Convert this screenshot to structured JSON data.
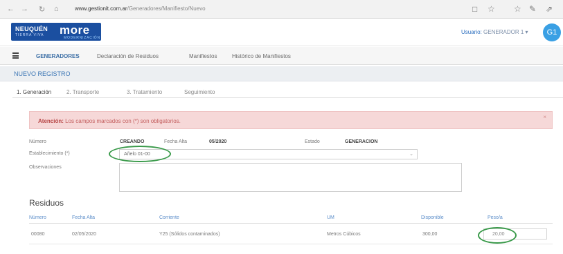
{
  "browser": {
    "back": "←",
    "forward": "→",
    "reload": "↻",
    "home": "⌂",
    "url_host": "www.gestionit.com.ar",
    "url_path": "/Generadores/Manifiesto/Nuevo",
    "icons": [
      "reading-view-icon",
      "favorite-star-icon",
      "favorites-hub-icon",
      "pen-icon",
      "share-icon"
    ],
    "right_glyphs": [
      "□",
      "☆",
      "☆",
      "✎",
      "⇗"
    ]
  },
  "header": {
    "logo_left": "NEUQUÉN",
    "logo_left_sub": "TIERRA VIVA",
    "logo_right": "more",
    "logo_right_sub": "MODERNIZACIÓN",
    "user_prefix": "Usuario:",
    "user_name": "GENERADOR 1",
    "user_caret": "▾",
    "avatar_initials": "G1"
  },
  "menu": {
    "items": [
      {
        "label": "GENERADORES",
        "active": true
      },
      {
        "label": "Declaración de Residuos",
        "active": false
      },
      {
        "label": "Manifiestos",
        "active": false
      },
      {
        "label": "Histórico de Manifiestos",
        "active": false
      }
    ]
  },
  "page": {
    "title": "NUEVO REGISTRO"
  },
  "tabs": [
    {
      "label": "1. Generación",
      "active": true
    },
    {
      "label": "2. Transporte",
      "active": false
    },
    {
      "label": "3. Tratamiento",
      "active": false
    },
    {
      "label": "Seguimiento",
      "active": false
    }
  ],
  "alert": {
    "strong": "Atención:",
    "text": "Los campos marcados con (*) son obligatorios.",
    "close": "×"
  },
  "form": {
    "numero_label": "Número",
    "numero_value": "CREANDO",
    "fecha_label": "Fecha Alta",
    "fecha_value": "05/2020",
    "estado_label": "Estado",
    "estado_value": "GENERACION",
    "establecimiento_label": "Establecimiento (*)",
    "establecimiento_value": "Añelo 01-00",
    "select_caret": "⌄",
    "observaciones_label": "Observaciones"
  },
  "residuos": {
    "title": "Residuos",
    "headers": [
      "Número",
      "Fecha Alta",
      "Corriente",
      "UM",
      "Disponible",
      "Peso/a"
    ],
    "rows": [
      [
        "00080",
        "02/05/2020",
        "Y25 (Sólidos contaminados)",
        "Metros Cúbicos",
        "300,00",
        "20,00"
      ]
    ]
  },
  "colors": {
    "brand_blue": "#1b4fa0",
    "accent_blue": "#3b6ea5",
    "alert_bg": "#f6d8d8",
    "annotation_green": "#3a9a4a",
    "avatar": "#3aa0e4"
  }
}
